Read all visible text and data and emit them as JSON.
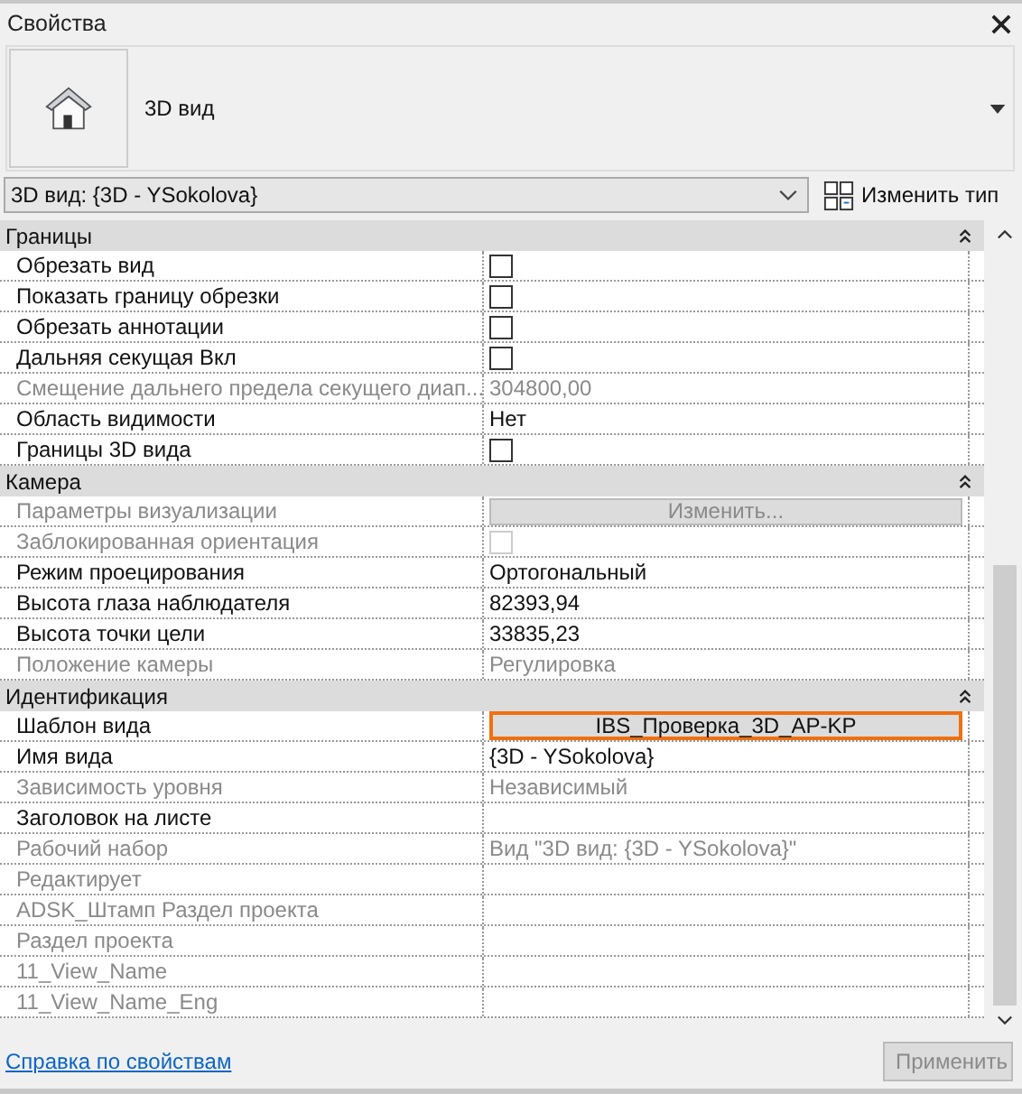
{
  "panel": {
    "title": "Свойства"
  },
  "type_selector": {
    "name": "3D вид"
  },
  "instance_dropdown": {
    "value": "3D вид: {3D - YSokolova}"
  },
  "edit_type_button": {
    "label": "Изменить тип"
  },
  "groups": [
    {
      "name": "Границы",
      "expanded": true,
      "rows": [
        {
          "label": "Обрезать вид",
          "disabled": false,
          "kind": "checkbox",
          "checked": false
        },
        {
          "label": "Показать границу обрезки",
          "disabled": false,
          "kind": "checkbox",
          "checked": false
        },
        {
          "label": "Обрезать аннотации",
          "disabled": false,
          "kind": "checkbox",
          "checked": false
        },
        {
          "label": "Дальняя секущая Вкл",
          "disabled": false,
          "kind": "checkbox",
          "checked": false
        },
        {
          "label": "Смещение дальнего предела секущего диап...",
          "disabled": true,
          "kind": "text",
          "value": "304800,00"
        },
        {
          "label": "Область видимости",
          "disabled": false,
          "kind": "text",
          "value": "Нет"
        },
        {
          "label": "Границы 3D вида",
          "disabled": false,
          "kind": "checkbox",
          "checked": false
        }
      ]
    },
    {
      "name": "Камера",
      "expanded": true,
      "rows": [
        {
          "label": "Параметры визуализации",
          "disabled": true,
          "kind": "button",
          "value": "Изменить..."
        },
        {
          "label": "Заблокированная ориентация",
          "disabled": true,
          "kind": "checkbox",
          "checked": false
        },
        {
          "label": "Режим проецирования",
          "disabled": false,
          "kind": "text",
          "value": "Ортогональный"
        },
        {
          "label": "Высота глаза наблюдателя",
          "disabled": false,
          "kind": "text",
          "value": "82393,94"
        },
        {
          "label": "Высота точки цели",
          "disabled": false,
          "kind": "text",
          "value": "33835,23"
        },
        {
          "label": "Положение камеры",
          "disabled": true,
          "kind": "text",
          "value": "Регулировка"
        }
      ]
    },
    {
      "name": "Идентификация",
      "expanded": true,
      "rows": [
        {
          "label": "Шаблон вида",
          "disabled": false,
          "kind": "template",
          "value": "IBS_Проверка_3D_AP-KP"
        },
        {
          "label": "Имя вида",
          "disabled": false,
          "kind": "text",
          "value": "{3D - YSokolova}"
        },
        {
          "label": "Зависимость уровня",
          "disabled": true,
          "kind": "text",
          "value": "Независимый"
        },
        {
          "label": "Заголовок на листе",
          "disabled": false,
          "kind": "text"
        },
        {
          "label": "Рабочий набор",
          "disabled": true,
          "kind": "text",
          "value": "Вид \"3D вид: {3D - YSokolova}\""
        },
        {
          "label": "Редактирует",
          "disabled": true,
          "kind": "text"
        },
        {
          "label": "ADSK_Штамп Раздел проекта",
          "disabled": true,
          "kind": "text"
        },
        {
          "label": "Раздел проекта",
          "disabled": true,
          "kind": "text"
        },
        {
          "label": "11_View_Name",
          "disabled": true,
          "kind": "text"
        },
        {
          "label": "11_View_Name_Eng",
          "disabled": true,
          "kind": "text"
        }
      ]
    }
  ],
  "footer": {
    "help_link": "Справка по свойствам",
    "apply_button": {
      "label": "Применить",
      "disabled": true
    }
  }
}
